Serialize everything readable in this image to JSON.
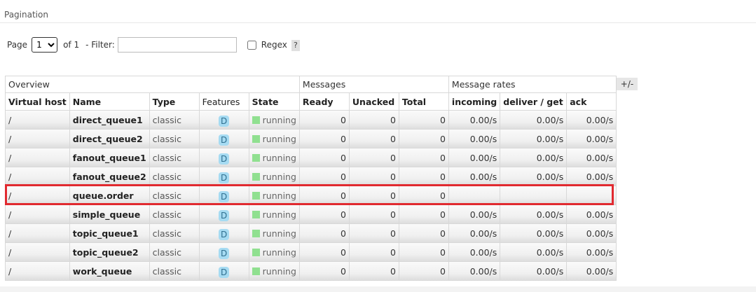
{
  "section": {
    "title": "Pagination"
  },
  "pager": {
    "page_label": "Page",
    "page_value": "1",
    "of_label": "of 1",
    "filter_label": "- Filter:",
    "filter_value": "",
    "regex_label": "Regex",
    "help_label": "?"
  },
  "table": {
    "groups": {
      "overview": "Overview",
      "messages": "Messages",
      "rates": "Message rates"
    },
    "columns": {
      "vhost": "Virtual host",
      "name": "Name",
      "type": "Type",
      "features": "Features",
      "state": "State",
      "ready": "Ready",
      "unacked": "Unacked",
      "total": "Total",
      "incoming": "incoming",
      "deliver": "deliver / get",
      "ack": "ack"
    },
    "rows": [
      {
        "vhost": "/",
        "name": "direct_queue1",
        "type": "classic",
        "feature": "D",
        "state": "running",
        "ready": "0",
        "unacked": "0",
        "total": "0",
        "incoming": "0.00/s",
        "deliver": "0.00/s",
        "ack": "0.00/s"
      },
      {
        "vhost": "/",
        "name": "direct_queue2",
        "type": "classic",
        "feature": "D",
        "state": "running",
        "ready": "0",
        "unacked": "0",
        "total": "0",
        "incoming": "0.00/s",
        "deliver": "0.00/s",
        "ack": "0.00/s"
      },
      {
        "vhost": "/",
        "name": "fanout_queue1",
        "type": "classic",
        "feature": "D",
        "state": "running",
        "ready": "0",
        "unacked": "0",
        "total": "0",
        "incoming": "0.00/s",
        "deliver": "0.00/s",
        "ack": "0.00/s"
      },
      {
        "vhost": "/",
        "name": "fanout_queue2",
        "type": "classic",
        "feature": "D",
        "state": "running",
        "ready": "0",
        "unacked": "0",
        "total": "0",
        "incoming": "0.00/s",
        "deliver": "0.00/s",
        "ack": "0.00/s"
      },
      {
        "vhost": "/",
        "name": "queue.order",
        "type": "classic",
        "feature": "D",
        "state": "running",
        "ready": "0",
        "unacked": "0",
        "total": "0",
        "incoming": "",
        "deliver": "",
        "ack": ""
      },
      {
        "vhost": "/",
        "name": "simple_queue",
        "type": "classic",
        "feature": "D",
        "state": "running",
        "ready": "0",
        "unacked": "0",
        "total": "0",
        "incoming": "0.00/s",
        "deliver": "0.00/s",
        "ack": "0.00/s"
      },
      {
        "vhost": "/",
        "name": "topic_queue1",
        "type": "classic",
        "feature": "D",
        "state": "running",
        "ready": "0",
        "unacked": "0",
        "total": "0",
        "incoming": "0.00/s",
        "deliver": "0.00/s",
        "ack": "0.00/s"
      },
      {
        "vhost": "/",
        "name": "topic_queue2",
        "type": "classic",
        "feature": "D",
        "state": "running",
        "ready": "0",
        "unacked": "0",
        "total": "0",
        "incoming": "0.00/s",
        "deliver": "0.00/s",
        "ack": "0.00/s"
      },
      {
        "vhost": "/",
        "name": "work_queue",
        "type": "classic",
        "feature": "D",
        "state": "running",
        "ready": "0",
        "unacked": "0",
        "total": "0",
        "incoming": "0.00/s",
        "deliver": "0.00/s",
        "ack": "0.00/s"
      }
    ],
    "toggle_label": "+/-",
    "highlight_color": "#e12a30",
    "state_color": "#90e090",
    "feature_badge_color": "#a6dbf2"
  }
}
